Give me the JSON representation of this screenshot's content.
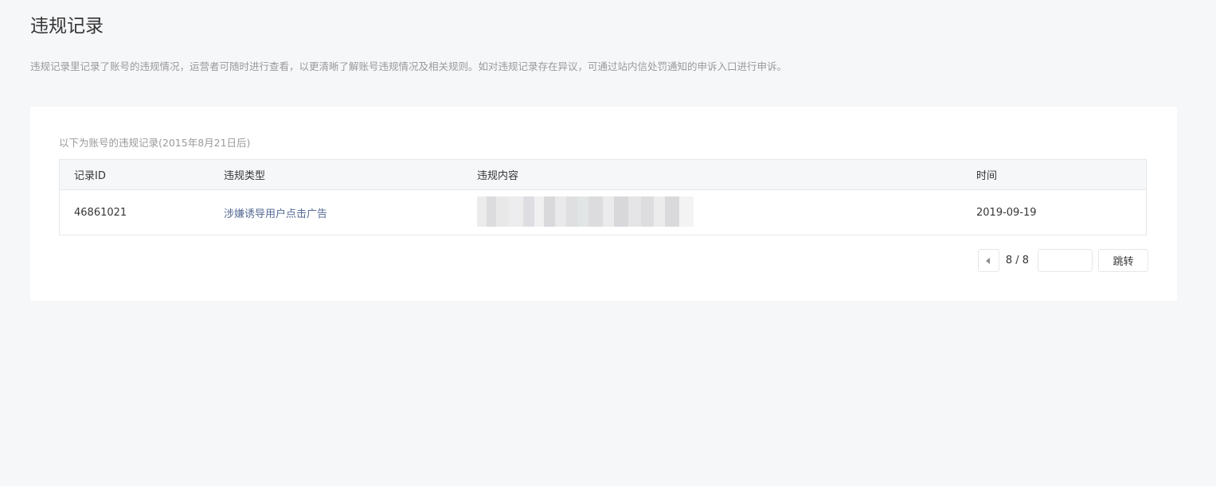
{
  "header": {
    "title": "违规记录",
    "description": "违规记录里记录了账号的违规情况，运营者可随时进行查看，以更清晰了解账号违规情况及相关规则。如对违规记录存在异议，可通过站内信处罚通知的申诉入口进行申诉。"
  },
  "records": {
    "section_label": "以下为账号的违规记录(2015年8月21日后)",
    "columns": [
      "记录ID",
      "违规类型",
      "违规内容",
      "时间"
    ],
    "rows": [
      {
        "id": "46861021",
        "type": "涉嫌诱导用户点击广告",
        "time": "2019-09-19"
      }
    ]
  },
  "pagination": {
    "page_indicator": "8 / 8",
    "jump_input_value": "",
    "jump_label": "跳转",
    "prev_icon": "caret-left-icon"
  },
  "colors": {
    "page_background": "#f6f7f9",
    "card_background": "#ffffff",
    "link": "#576b95",
    "muted_text": "#9a9a9a",
    "border": "#e4e8eb"
  }
}
